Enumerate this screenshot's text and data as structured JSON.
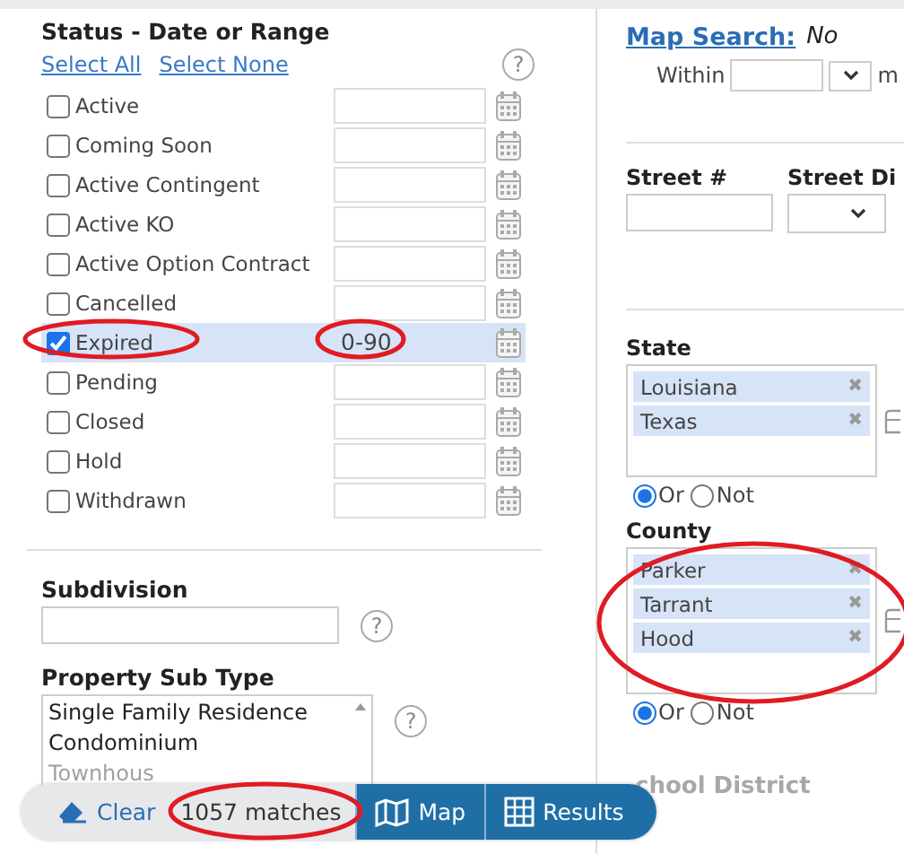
{
  "status_panel": {
    "title": "Status - Date or Range",
    "links": [
      "Select All",
      "Select None"
    ],
    "help": "?",
    "rows": [
      {
        "label": "Active",
        "checked": false
      },
      {
        "label": "Coming Soon",
        "checked": false
      },
      {
        "label": "Active Contingent",
        "checked": false
      },
      {
        "label": "Active KO",
        "checked": false
      },
      {
        "label": "Active Option Contract",
        "checked": false
      },
      {
        "label": "Cancelled",
        "checked": false
      },
      {
        "label": "Expired",
        "checked": true,
        "range": "0-90"
      },
      {
        "label": "Pending",
        "checked": false
      },
      {
        "label": "Closed",
        "checked": false
      },
      {
        "label": "Hold",
        "checked": false
      },
      {
        "label": "Withdrawn",
        "checked": false
      }
    ]
  },
  "subdivision": {
    "label": "Subdivision",
    "help": "?"
  },
  "property_sub_type": {
    "label": "Property Sub Type",
    "help": "?",
    "options": [
      "Single Family Residence",
      "Condominium",
      "Townhous"
    ]
  },
  "map_search": {
    "link": "Map Search:",
    "note": "No",
    "within": "Within",
    "unit": "m"
  },
  "street": {
    "number_label": "Street #",
    "dir_label": "Street Di"
  },
  "state": {
    "label": "State",
    "items": [
      {
        "name": "Louisiana",
        "remove": "✖"
      },
      {
        "name": "Texas",
        "remove": "✖"
      }
    ],
    "modes": [
      {
        "label": "Or",
        "selected": true
      },
      {
        "label": "Not",
        "selected": false
      }
    ]
  },
  "county": {
    "label": "County",
    "items": [
      {
        "name": "Parker",
        "remove": "✖"
      },
      {
        "name": "Tarrant",
        "remove": "✖"
      },
      {
        "name": "Hood",
        "remove": "✖"
      }
    ],
    "modes": [
      {
        "label": "Or",
        "selected": true
      },
      {
        "label": "Not",
        "selected": false
      }
    ]
  },
  "next_section": "chool District",
  "action_bar": {
    "clear": "Clear",
    "matches": "1057 matches",
    "map": "Map",
    "results": "Results"
  }
}
